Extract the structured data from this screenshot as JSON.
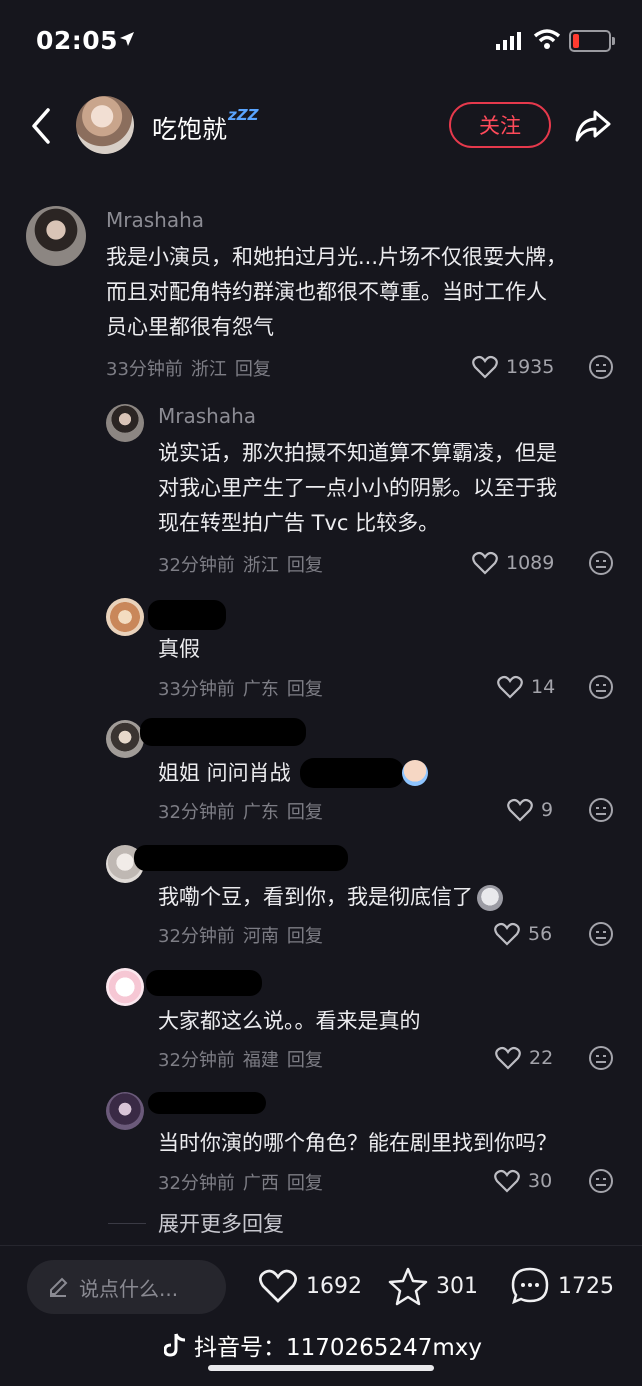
{
  "status_bar": {
    "time": "02:05"
  },
  "header": {
    "name": "吃饱就",
    "name_suffix": "zZZ",
    "follow_label": "关注"
  },
  "comments": [
    {
      "username": "Mrashaha",
      "text_lines": [
        "我是小演员，和她拍过月光...片场不仅很耍大牌，",
        "而且对配角特约群演也都很不尊重。当时工作人",
        "员心里都很有怨气"
      ],
      "time": "33分钟前",
      "region": "浙江",
      "reply": "回复",
      "likes": "1935"
    },
    {
      "username": "Mrashaha",
      "text_lines": [
        "说实话，那次拍摄不知道算不算霸凌，但是",
        "对我心里产生了一点小小的阴影。以至于我",
        "现在转型拍广告 Tvc 比较多。"
      ],
      "time": "32分钟前",
      "region": "浙江",
      "reply": "回复",
      "likes": "1089"
    },
    {
      "username": "",
      "text_lines": [
        "真假"
      ],
      "time": "33分钟前",
      "region": "广东",
      "reply": "回复",
      "likes": "14"
    },
    {
      "username": "",
      "text_lines": [
        "姐姐 问问肖战"
      ],
      "time": "32分钟前",
      "region": "广东",
      "reply": "回复",
      "likes": "9"
    },
    {
      "username": "",
      "text_lines": [
        "我嘞个豆，看到你，我是彻底信了"
      ],
      "time": "32分钟前",
      "region": "河南",
      "reply": "回复",
      "likes": "56"
    },
    {
      "username": "",
      "text_lines": [
        "大家都这么说。。看来是真的"
      ],
      "time": "32分钟前",
      "region": "福建",
      "reply": "回复",
      "likes": "22"
    },
    {
      "username": "",
      "text_lines": [
        "当时你演的哪个角色？能在剧里找到你吗？"
      ],
      "time": "32分钟前",
      "region": "广西",
      "reply": "回复",
      "likes": "30"
    }
  ],
  "expand_replies": "展开更多回复",
  "bottom": {
    "input_placeholder": "说点什么...",
    "likes": "1692",
    "favorites": "301",
    "comments": "1725"
  },
  "watermark": "抖音号：1170265247mxy",
  "colors": {
    "background": "#16161d",
    "accent": "#e6394c",
    "text": "#ececef",
    "meta": "#7d7d85"
  },
  "icons": [
    "navigation-arrow-icon",
    "signal-icon",
    "wifi-icon",
    "battery-icon",
    "back-chevron-icon",
    "share-arrow-icon",
    "heart-icon",
    "dislike-face-icon",
    "pencil-icon",
    "star-icon",
    "comment-bubble-icon",
    "douyin-logo-icon"
  ]
}
